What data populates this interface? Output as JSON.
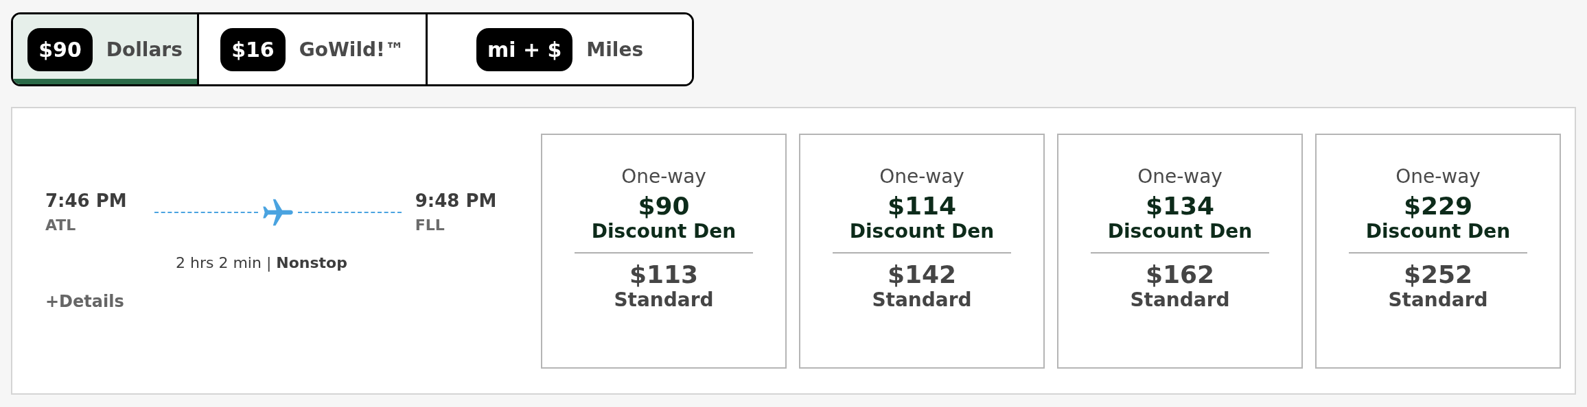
{
  "tabs": [
    {
      "badge": "$90",
      "label": "Dollars",
      "selected": true
    },
    {
      "badge": "$16",
      "label": "GoWild!™",
      "selected": false
    },
    {
      "badge": "mi + $",
      "label": "Miles",
      "selected": false
    }
  ],
  "flight": {
    "depart_time": "7:46 PM",
    "depart_airport": "ATL",
    "arrive_time": "9:48 PM",
    "arrive_airport": "FLL",
    "duration": "2 hrs 2 min | **Nonstop**",
    "details_link": "+Details"
  },
  "fares": [
    {
      "trip": "One-way",
      "discount_price": "$90",
      "discount_label": "Discount Den",
      "standard_price": "$113",
      "standard_label": "Standard"
    },
    {
      "trip": "One-way",
      "discount_price": "$114",
      "discount_label": "Discount Den",
      "standard_price": "$142",
      "standard_label": "Standard"
    },
    {
      "trip": "One-way",
      "discount_price": "$134",
      "discount_label": "Discount Den",
      "standard_price": "$162",
      "standard_label": "Standard"
    },
    {
      "trip": "One-way",
      "discount_price": "$229",
      "discount_label": "Discount Den",
      "standard_price": "$252",
      "standard_label": "Standard"
    }
  ]
}
